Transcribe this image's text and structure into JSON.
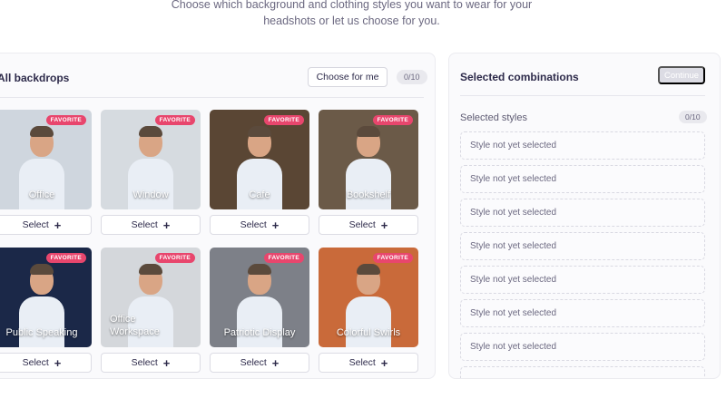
{
  "header": {
    "subtitle_line1": "Choose which background and clothing styles you want to wear for your",
    "subtitle_line2": "headshots or let us choose for you."
  },
  "backdrops": {
    "title": "All backdrops",
    "choose_label": "Choose for me",
    "count": "0/10",
    "favorite_badge": "FAVORITE",
    "select_label": "Select",
    "items": [
      {
        "label": "Office",
        "bg": "#cfd6de"
      },
      {
        "label": "Window",
        "bg": "#d6dbe0"
      },
      {
        "label": "Cafe",
        "bg": "#5a4634"
      },
      {
        "label": "Bookshelf",
        "bg": "#6b5a48"
      },
      {
        "label": "Public Speaking",
        "bg": "#1b2848"
      },
      {
        "label": "Office\nWorkspace",
        "bg": "#d4d7db"
      },
      {
        "label": "Patriotic Display",
        "bg": "#7d8088"
      },
      {
        "label": "Colorful Swirls",
        "bg": "#c96a3a"
      }
    ]
  },
  "selected": {
    "title": "Selected combinations",
    "continue_label": "Continue",
    "styles_label": "Selected styles",
    "styles_count": "0/10",
    "slot_text": "Style not yet selected",
    "slots": [
      "Style not yet selected",
      "Style not yet selected",
      "Style not yet selected",
      "Style not yet selected",
      "Style not yet selected",
      "Style not yet selected",
      "Style not yet selected",
      ""
    ]
  },
  "colors": {
    "favorite": "#e8466d",
    "accent_text": "#2d2a4a",
    "panel_bg": "#fafafc"
  }
}
